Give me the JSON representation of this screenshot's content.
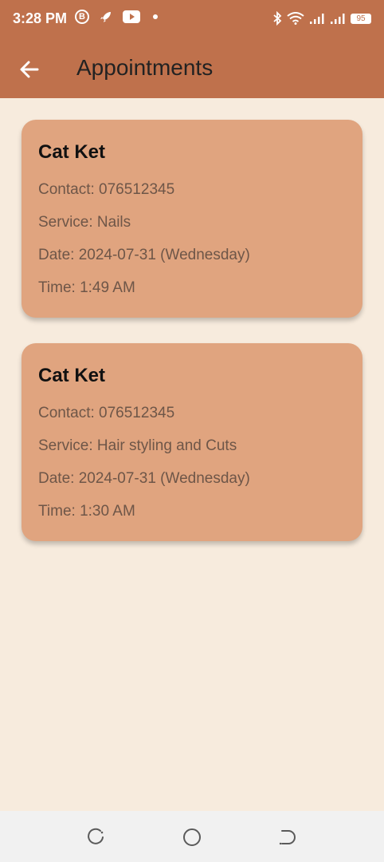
{
  "status_bar": {
    "time": "3:28 PM",
    "battery": "95",
    "icons": [
      "b-circle-icon",
      "rocket-icon",
      "youtube-icon",
      "dot-icon",
      "bluetooth-icon",
      "wifi-icon",
      "signal-icon",
      "signal-icon",
      "battery-icon"
    ]
  },
  "appbar": {
    "title": "Appointments",
    "back_icon": "arrow-left-icon"
  },
  "appointments": [
    {
      "name": "Cat Ket",
      "contact": "Contact: 076512345",
      "service": "Service: Nails",
      "date": "Date: 2024-07-31 (Wednesday)",
      "time": "Time: 1:49 AM"
    },
    {
      "name": "Cat Ket",
      "contact": "Contact: 076512345",
      "service": "Service: Hair styling and Cuts",
      "date": "Date: 2024-07-31 (Wednesday)",
      "time": "Time: 1:30 AM"
    }
  ],
  "nav_bar": {
    "buttons": [
      "recent-apps-icon",
      "home-icon",
      "back-gesture-icon"
    ]
  },
  "colors": {
    "appbar": "#bf714c",
    "background": "#f7ebdd",
    "card": "#e0a47f"
  }
}
